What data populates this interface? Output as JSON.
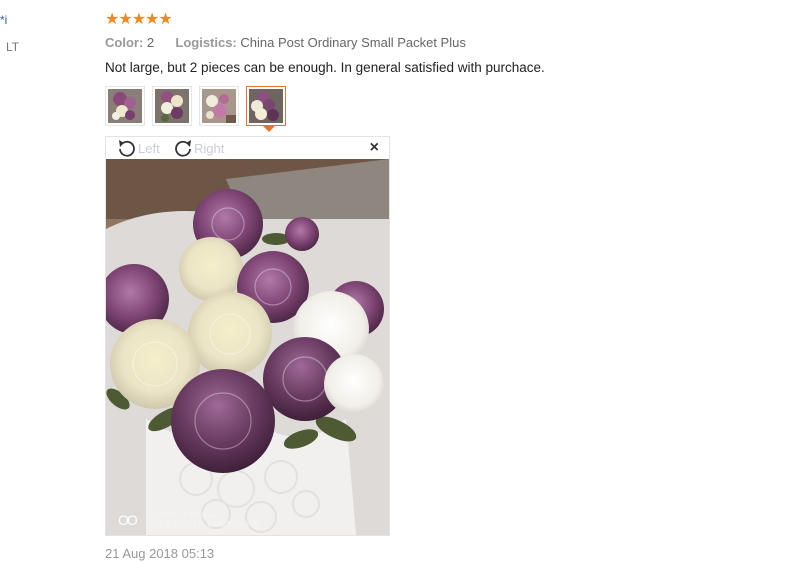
{
  "user": {
    "name": "*i",
    "country": "LT"
  },
  "review": {
    "rating": 5,
    "rating_max": 5,
    "color_label": "Color:",
    "color_value": "2",
    "logistics_label": "Logistics:",
    "logistics_value": "China Post Ordinary Small Packet Plus",
    "comment": "Not large, but 2 pieces can be enough. In general satisfied with purchace.",
    "date": "21 Aug 2018 05:13"
  },
  "viewer": {
    "rotate_left_label": "Left",
    "rotate_right_label": "Right",
    "close_label": "×",
    "watermark_line1": "HUAWEI P20 Pro",
    "watermark_line2": "LEICA TRIPLE CAMERA | AI",
    "watermark_icon": "OO"
  },
  "thumbnails": [
    {
      "name": "photo-1",
      "active": false
    },
    {
      "name": "photo-2",
      "active": false
    },
    {
      "name": "photo-3",
      "active": false
    },
    {
      "name": "photo-4",
      "active": true
    }
  ],
  "icons": {
    "star": "star-icon",
    "rotate_left": "rotate-left-icon",
    "rotate_right": "rotate-right-icon",
    "close": "close-icon"
  },
  "colors": {
    "star": "#f2891e",
    "active_thumb": "#e8732c",
    "link": "#2b5fb4"
  }
}
